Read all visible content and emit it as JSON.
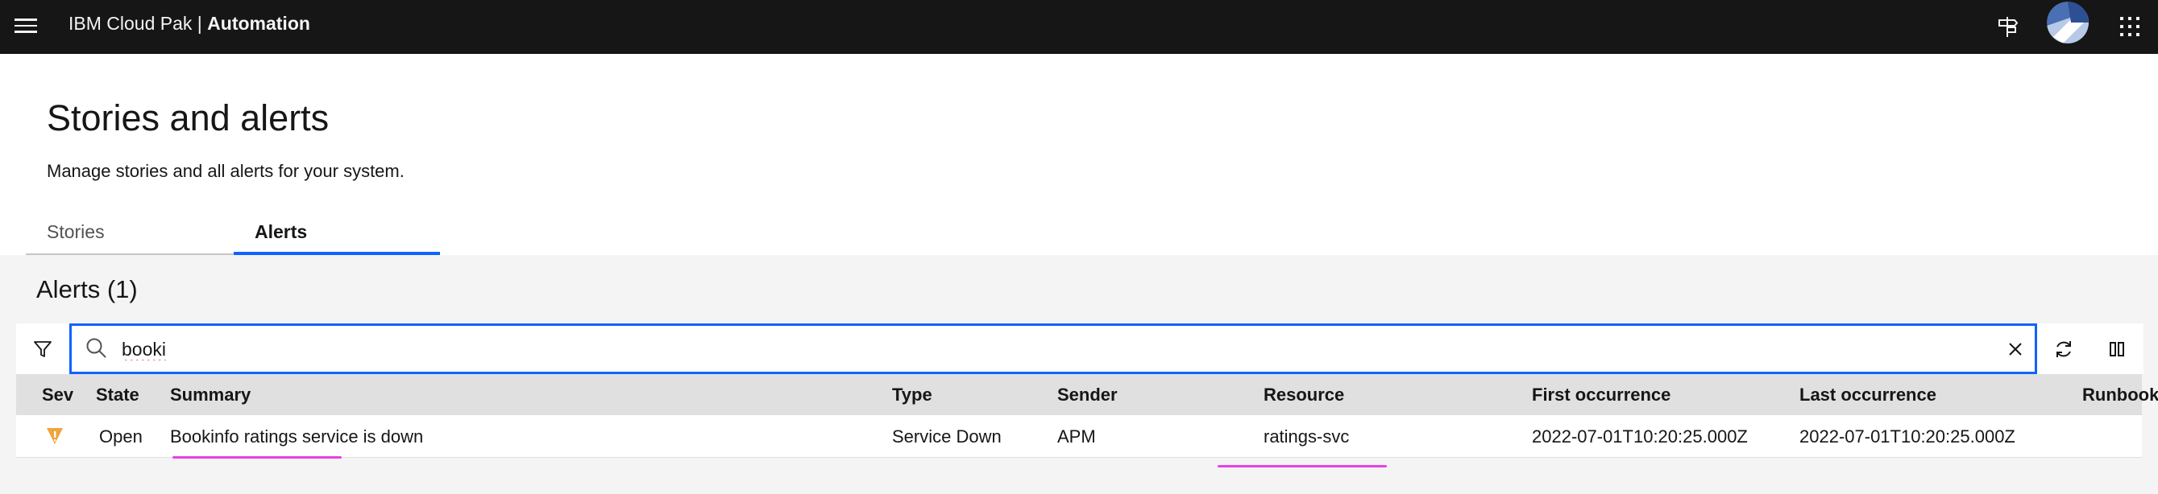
{
  "header": {
    "brand_prefix": "IBM Cloud Pak | ",
    "brand_product": "Automation"
  },
  "page": {
    "title": "Stories and alerts",
    "subtitle": "Manage stories and all alerts for your system."
  },
  "tabs": [
    {
      "label": "Stories",
      "selected": false
    },
    {
      "label": "Alerts",
      "selected": true
    }
  ],
  "alerts": {
    "heading": "Alerts (1)",
    "search_value": "booki"
  },
  "table": {
    "columns": [
      "Sev",
      "State",
      "Summary",
      "Type",
      "Sender",
      "Resource",
      "First occurrence",
      "Last occurrence",
      "Runbook"
    ],
    "rows": [
      {
        "severity_icon": "warning-icon",
        "state": "Open",
        "summary": "Bookinfo ratings service is down",
        "type": "Service Down",
        "sender": "APM",
        "resource": "ratings-svc",
        "first_occurrence": "2022-07-01T10:20:25.000Z",
        "last_occurrence": "2022-07-01T10:20:25.000Z"
      }
    ]
  },
  "colors": {
    "header_bg": "#161616",
    "accent": "#0f62fe",
    "warning": "#f1a43d",
    "annotation": "#e641e6"
  }
}
